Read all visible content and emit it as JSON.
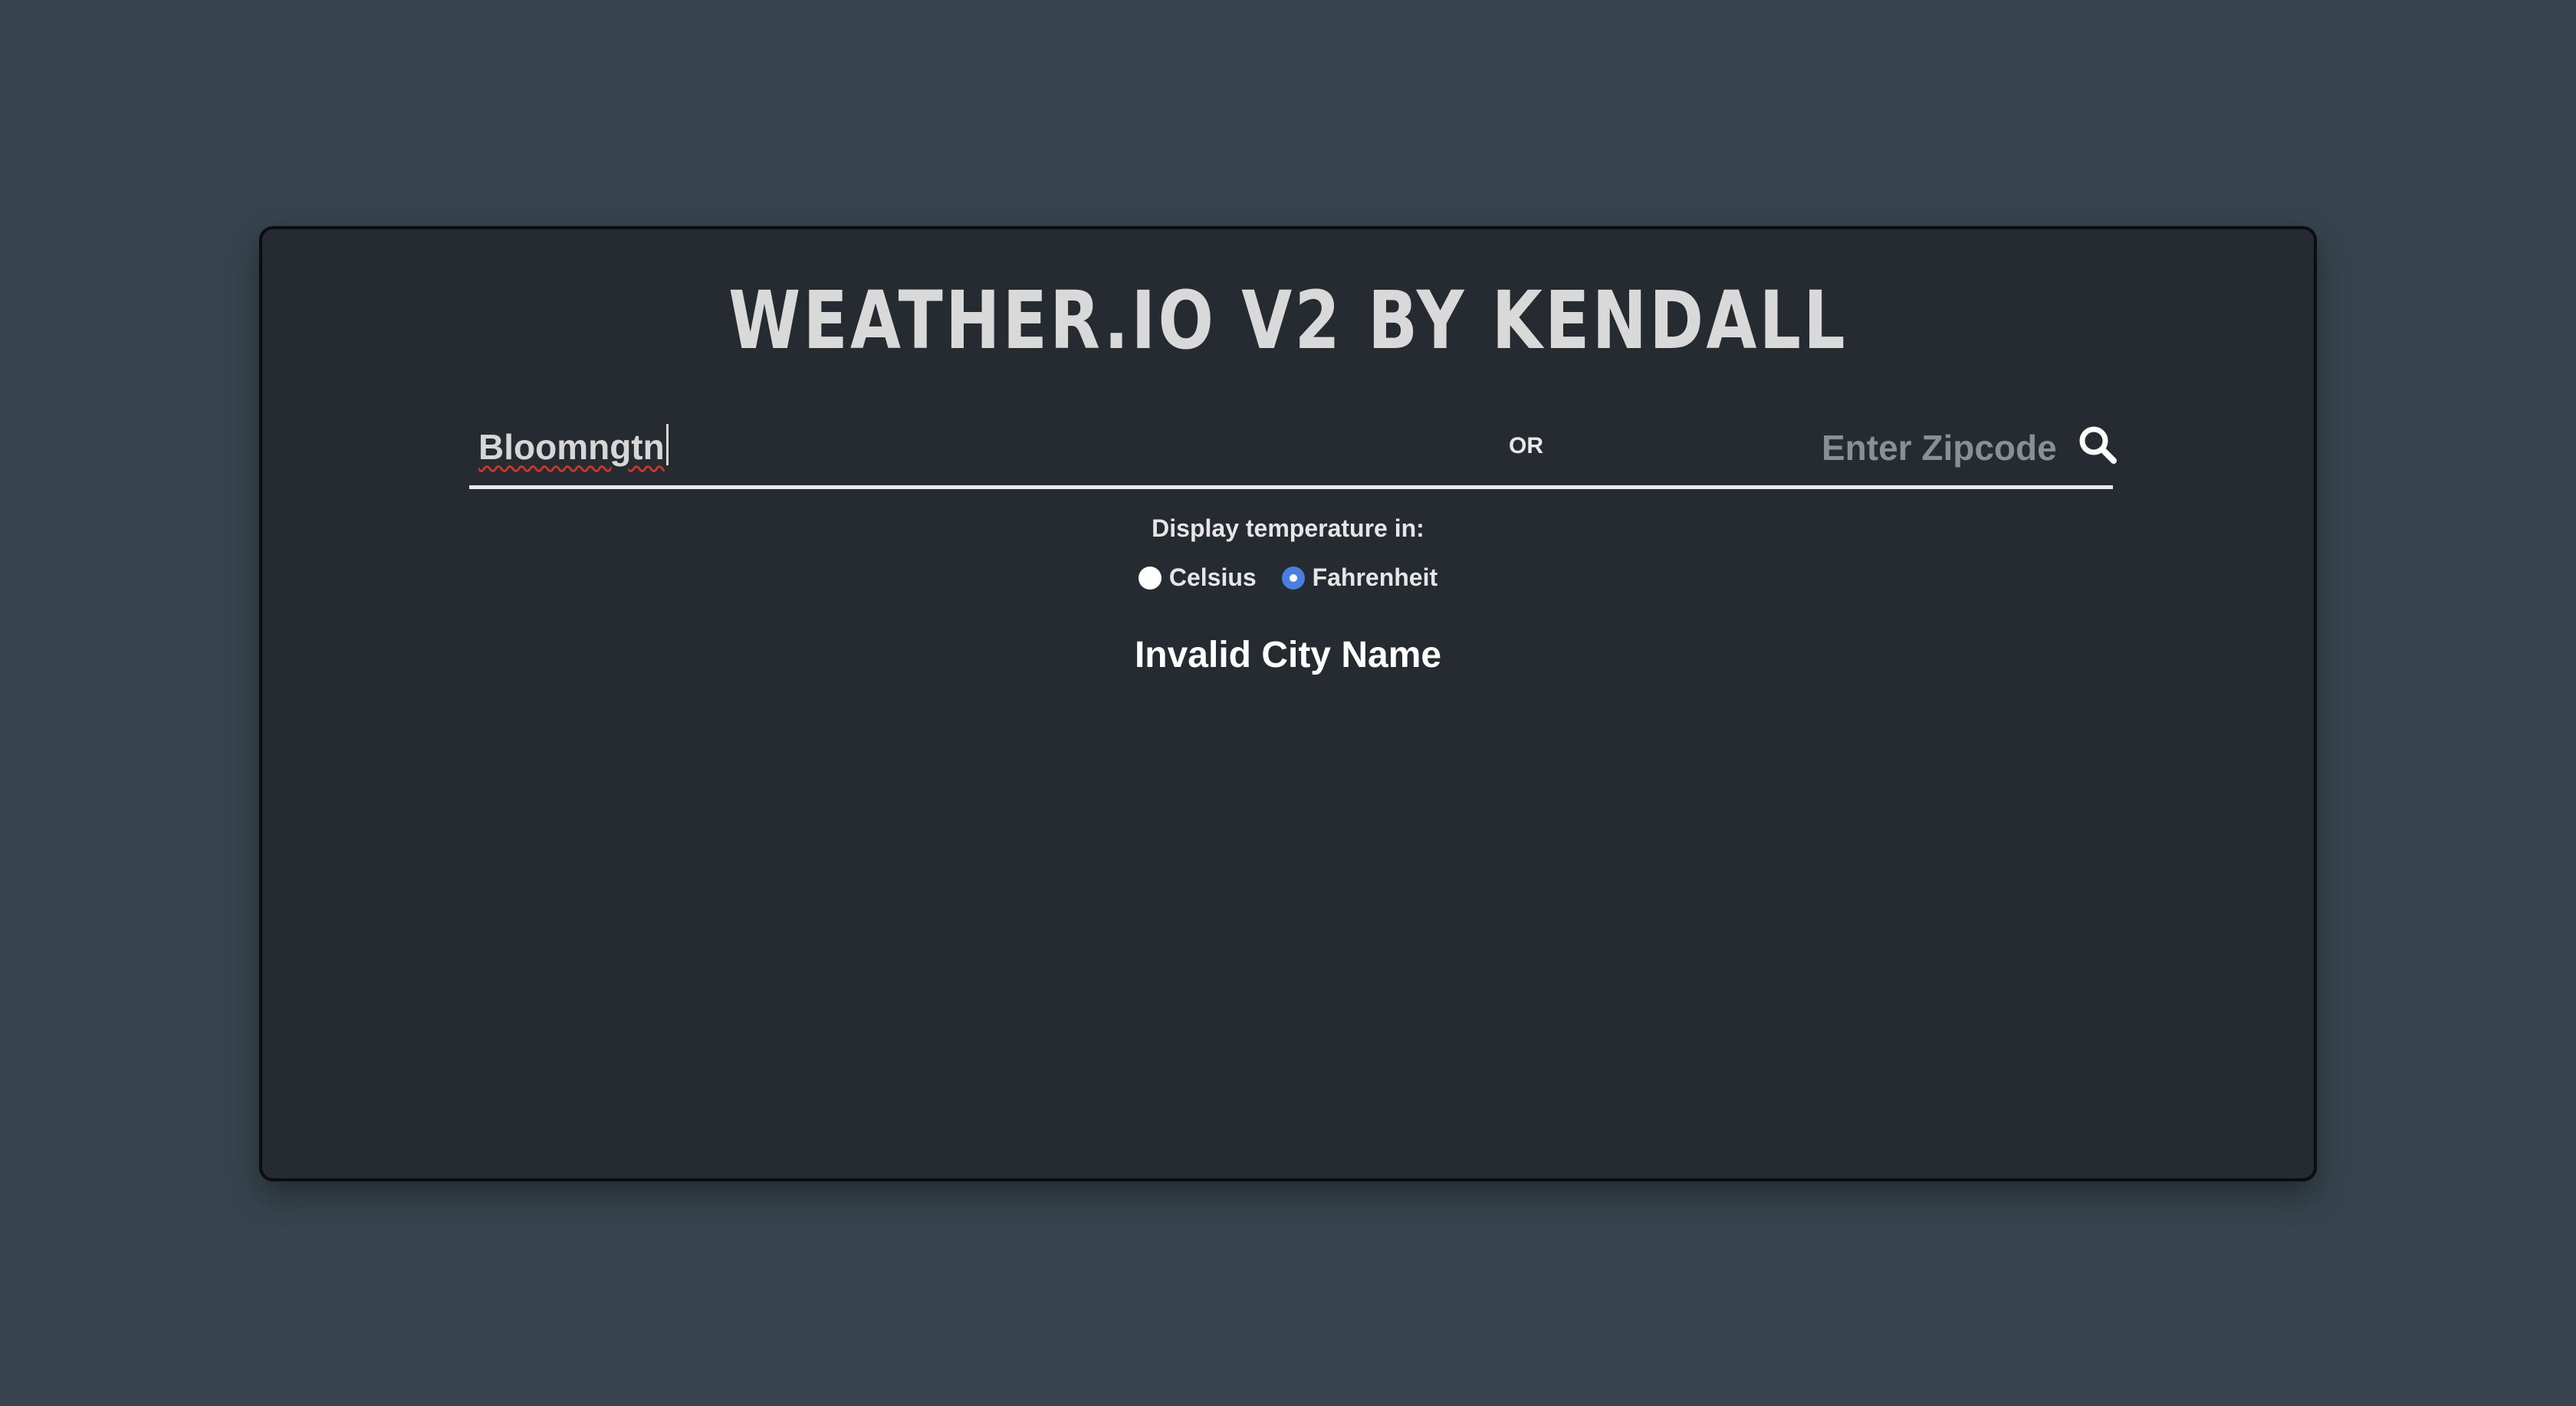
{
  "app": {
    "title": "WEATHER.IO V2 BY KENDALL"
  },
  "search": {
    "city_value": "Bloomngtn",
    "or_label": "OR",
    "zip_placeholder": "Enter Zipcode",
    "search_icon": "search-icon"
  },
  "units": {
    "label": "Display temperature in:",
    "options": [
      {
        "label": "Celsius",
        "checked": false
      },
      {
        "label": "Fahrenheit",
        "checked": true
      }
    ],
    "accent_color": "#4a7fe0"
  },
  "status": {
    "message": "Invalid City Name"
  },
  "colors": {
    "background": "#37444d",
    "card": "#262b31"
  }
}
